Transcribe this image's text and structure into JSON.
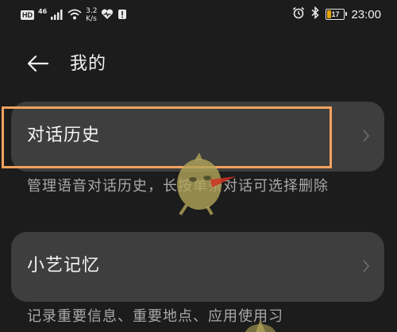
{
  "status_bar": {
    "hd": "HD",
    "signal": "46",
    "speed_value": "3.2",
    "speed_unit": "K/s",
    "battery": "17",
    "time": "23:00"
  },
  "header": {
    "title": "我的"
  },
  "items": [
    {
      "label": "对话历史",
      "description": "管理语音对话历史，长按单条对话可选择删除"
    },
    {
      "label": "小艺记忆",
      "description": "记录重要信息、重要地点、应用使用习"
    }
  ],
  "colors": {
    "highlight": "#f5a25f",
    "card": "#3e3e3e",
    "background": "#1c1c1c"
  }
}
